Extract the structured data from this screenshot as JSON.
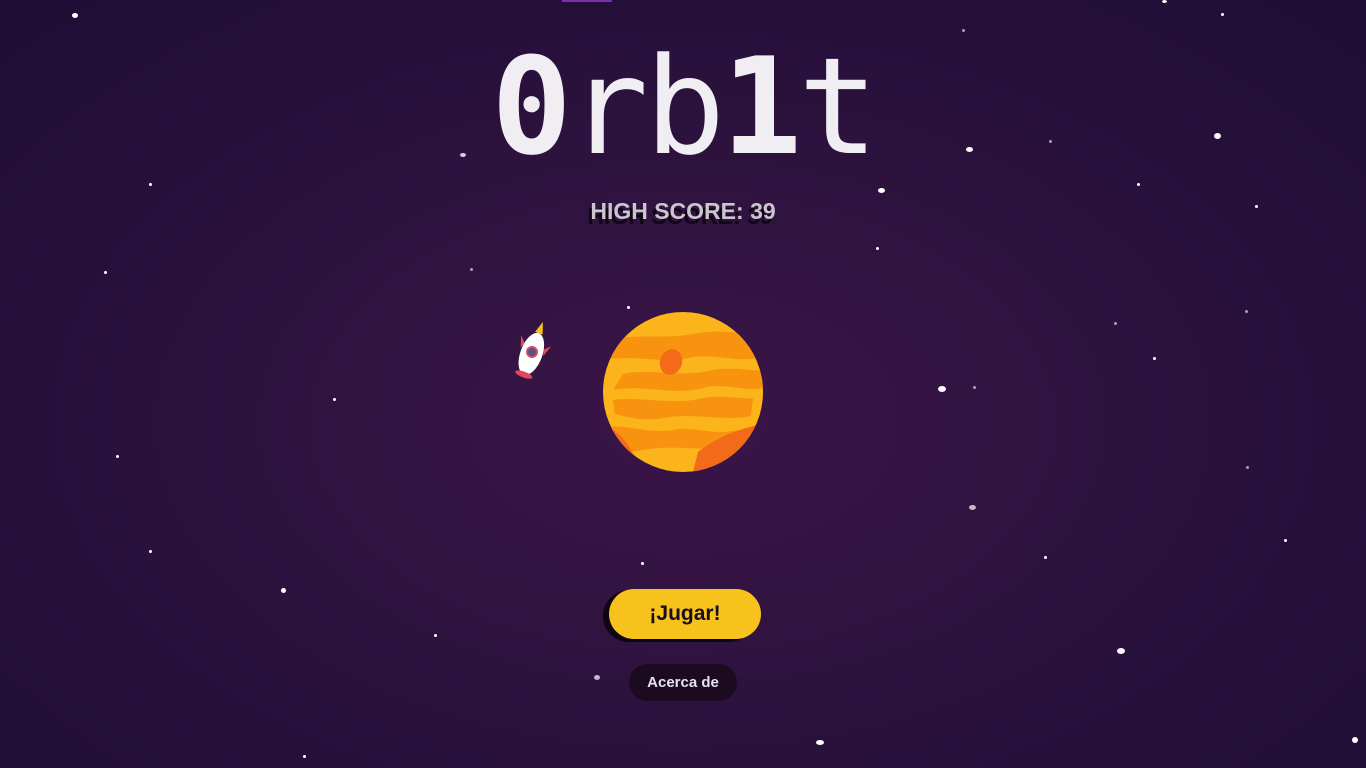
{
  "game": {
    "title_parts": [
      "0",
      "rb",
      "1",
      "t"
    ],
    "high_score_label": "HIGH SCORE:",
    "high_score_value": "39",
    "play_label": "¡Jugar!",
    "about_label": "Acerca de"
  },
  "icons": {
    "planet": "planet-icon",
    "rocket": "rocket-icon"
  },
  "colors": {
    "background": "#2a1140",
    "title": "#f0eef2",
    "play_button": "#f7c21b",
    "about_button": "#1b0a20",
    "planet": "#f7a21b"
  }
}
